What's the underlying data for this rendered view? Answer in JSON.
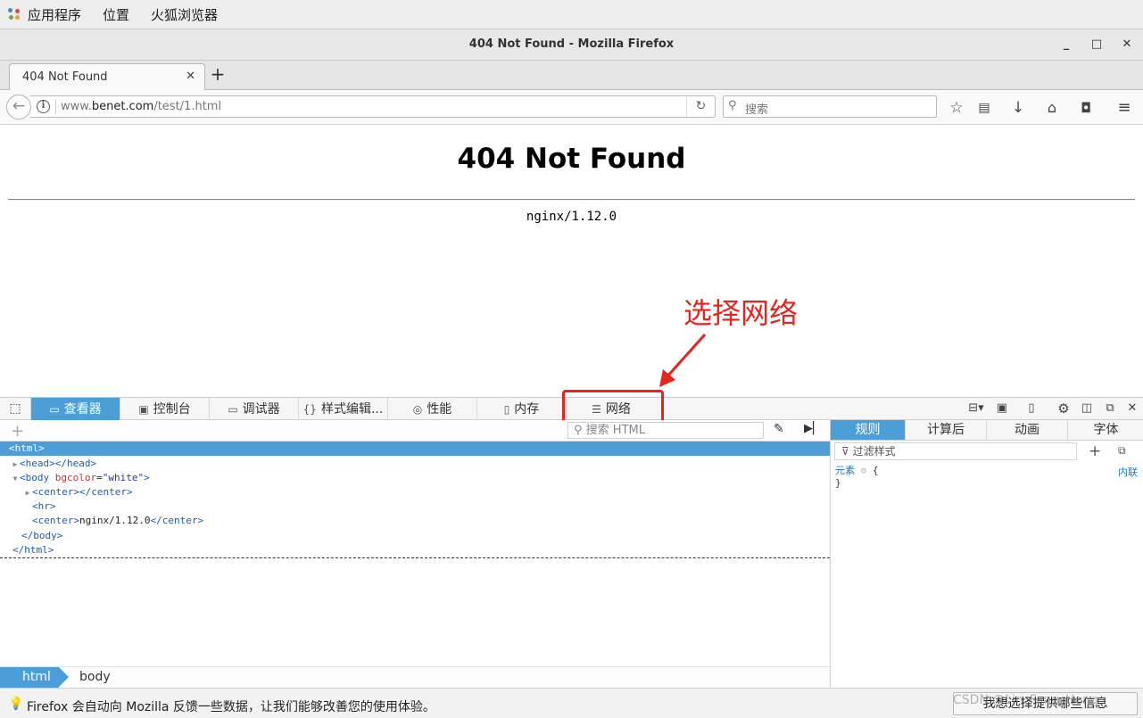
{
  "topbar": {
    "applications": "应用程序",
    "places": "位置",
    "firefox": "火狐浏览器"
  },
  "window": {
    "title": "404 Not Found - Mozilla Firefox"
  },
  "tabs": [
    {
      "label": "404 Not Found"
    }
  ],
  "nav": {
    "url_prefix": "www.",
    "url_domain": "benet.com",
    "url_path": "/test/1.html",
    "search_placeholder": "搜索"
  },
  "page": {
    "heading": "404 Not Found",
    "server": "nginx/1.12.0"
  },
  "annotation": {
    "text": "选择网络",
    "color": "#e8231c"
  },
  "devtools": {
    "tabs": [
      {
        "label": "查看器",
        "icon": "inspector-icon"
      },
      {
        "label": "控制台",
        "icon": "console-icon"
      },
      {
        "label": "调试器",
        "icon": "debugger-icon"
      },
      {
        "label": "样式编辑...",
        "icon": "style-editor-icon"
      },
      {
        "label": "性能",
        "icon": "performance-icon"
      },
      {
        "label": "内存",
        "icon": "memory-icon"
      },
      {
        "label": "网络",
        "icon": "network-icon"
      }
    ],
    "selected_tab": "查看器",
    "search_placeholder": "搜索 HTML",
    "markup": {
      "html_open": "<html>",
      "head_open": "head",
      "head_close": "head",
      "body_tag": "body",
      "body_attr": "bgcolor",
      "body_attr_value": "\"white\"",
      "center1_open": "center",
      "center1_close": "center",
      "hr": "hr",
      "center2_open": "center",
      "center2_text": "nginx/1.12.0",
      "center2_close": "center",
      "body_close": "body",
      "html_close": "html"
    },
    "breadcrumbs": [
      "html",
      "body"
    ],
    "side_tabs": [
      "规则",
      "计算后",
      "动画",
      "字体"
    ],
    "filter_placeholder": "过滤样式",
    "rule_selector": "元素",
    "rule_open": "{",
    "rule_close": "}",
    "inline_label": "内联"
  },
  "notification": {
    "text": "Firefox 会自动向 Mozilla 反馈一些数据，让我们能够改善您的使用体验。",
    "button": "我想选择提供哪些信息"
  },
  "watermark": "CSDN @Lin_Fang_Heng",
  "accent_color": "#4c9ed9"
}
